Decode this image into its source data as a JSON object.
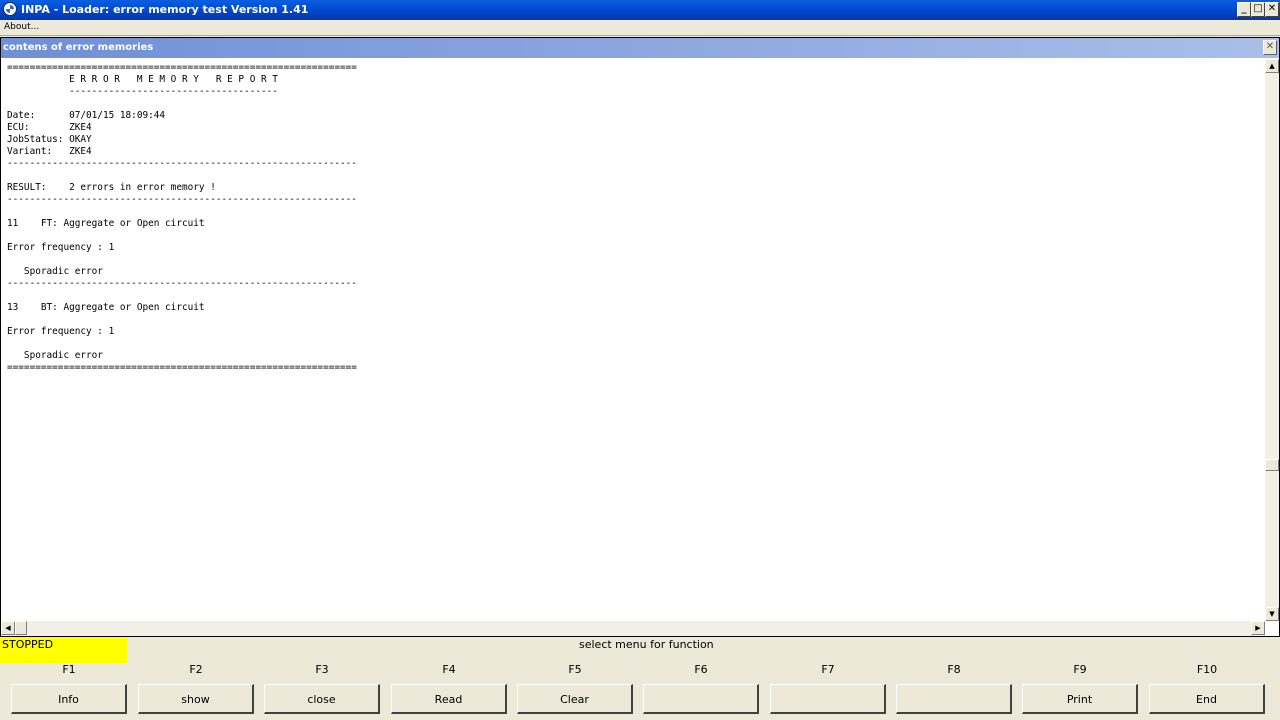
{
  "window": {
    "title": "INPA - Loader:  error memory test  Version 1.41",
    "minimize_glyph": "_",
    "maximize_glyph": "□",
    "close_glyph": "✕"
  },
  "menu": {
    "about": "About..."
  },
  "inner_window": {
    "title": "contens of error memories",
    "close_glyph": "✕"
  },
  "report_lines": [
    "==============================================================",
    "           E R R O R   M E M O R Y   R E P O R T",
    "           -------------------------------------",
    "",
    "Date:      07/01/15 18:09:44",
    "ECU:       ZKE4",
    "JobStatus: OKAY",
    "Variant:   ZKE4",
    "--------------------------------------------------------------",
    "",
    "RESULT:    2 errors in error memory !",
    "--------------------------------------------------------------",
    "",
    "11    FT: Aggregate or Open circuit",
    "",
    "Error frequency : 1",
    "",
    "   Sporadic error",
    "--------------------------------------------------------------",
    "",
    "13    BT: Aggregate or Open circuit",
    "",
    "Error frequency : 1",
    "",
    "   Sporadic error",
    "=============================================================="
  ],
  "scroll": {
    "up": "▲",
    "down": "▼",
    "left": "◀",
    "right": "▶"
  },
  "status": {
    "state": "STOPPED",
    "state_color": "#ffff00",
    "hint": "select menu for function"
  },
  "function_keys": [
    {
      "key": "F1",
      "label": "Info"
    },
    {
      "key": "F2",
      "label": "show"
    },
    {
      "key": "F3",
      "label": "close"
    },
    {
      "key": "F4",
      "label": "Read"
    },
    {
      "key": "F5",
      "label": "Clear"
    },
    {
      "key": "F6",
      "label": ""
    },
    {
      "key": "F7",
      "label": ""
    },
    {
      "key": "F8",
      "label": ""
    },
    {
      "key": "F9",
      "label": "Print"
    },
    {
      "key": "F10",
      "label": "End"
    }
  ]
}
